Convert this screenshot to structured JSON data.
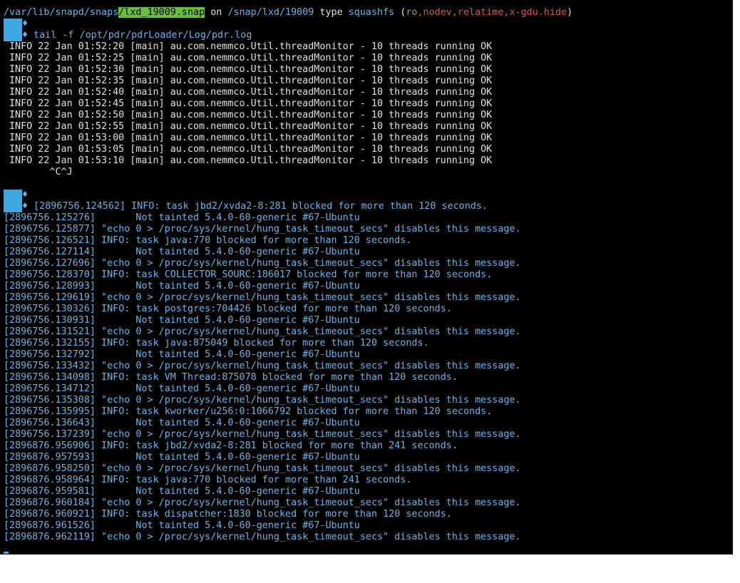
{
  "mount": {
    "path_prefix": "/var/lib/snapd/snaps",
    "path_highlight": "/lxd_19009.snap",
    "on_word": " on ",
    "target": "/snap/lxd/19009",
    "type_word": " type ",
    "fstype": "squashfs",
    "opts_open": " (",
    "opt_ro": "ro",
    "opt_rest": ",nodev,relatime,x-gdu.hide",
    "opts_close": ")"
  },
  "prompt": {
    "diamond": "♦",
    "command": " tail -f /opt/pdr/pdrLoader/Log/pdr.log"
  },
  "info_lines": [
    "INFO 22 Jan 01:52:20 [main] au.com.nemmco.Util.threadMonitor - 10 threads running OK",
    "INFO 22 Jan 01:52:25 [main] au.com.nemmco.Util.threadMonitor - 10 threads running OK",
    "INFO 22 Jan 01:52:30 [main] au.com.nemmco.Util.threadMonitor - 10 threads running OK",
    "INFO 22 Jan 01:52:35 [main] au.com.nemmco.Util.threadMonitor - 10 threads running OK",
    "INFO 22 Jan 01:52:40 [main] au.com.nemmco.Util.threadMonitor - 10 threads running OK",
    "INFO 22 Jan 01:52:45 [main] au.com.nemmco.Util.threadMonitor - 10 threads running OK",
    "INFO 22 Jan 01:52:50 [main] au.com.nemmco.Util.threadMonitor - 10 threads running OK",
    "INFO 22 Jan 01:52:55 [main] au.com.nemmco.Util.threadMonitor - 10 threads running OK",
    "INFO 22 Jan 01:53:00 [main] au.com.nemmco.Util.threadMonitor - 10 threads running OK",
    "INFO 22 Jan 01:53:05 [main] au.com.nemmco.Util.threadMonitor - 10 threads running OK",
    "INFO 22 Jan 01:53:10 [main] au.com.nemmco.Util.threadMonitor - 10 threads running OK"
  ],
  "interrupt": "        ^C^J",
  "kernel_first": " [2896756.124562] INFO: task jbd2/xvda2-8:281 blocked for more than 120 seconds.",
  "kernel_lines": [
    "[2896756.125276]       Not tainted 5.4.0-60-generic #67-Ubuntu",
    "[2896756.125877] \"echo 0 > /proc/sys/kernel/hung_task_timeout_secs\" disables this message.",
    "[2896756.126521] INFO: task java:770 blocked for more than 120 seconds.",
    "[2896756.127114]       Not tainted 5.4.0-60-generic #67-Ubuntu",
    "[2896756.127696] \"echo 0 > /proc/sys/kernel/hung_task_timeout_secs\" disables this message.",
    "[2896756.128370] INFO: task COLLECTOR_SOURC:186017 blocked for more than 120 seconds.",
    "[2896756.128993]       Not tainted 5.4.0-60-generic #67-Ubuntu",
    "[2896756.129619] \"echo 0 > /proc/sys/kernel/hung_task_timeout_secs\" disables this message.",
    "[2896756.130326] INFO: task postgres:704426 blocked for more than 120 seconds.",
    "[2896756.130931]       Not tainted 5.4.0-60-generic #67-Ubuntu",
    "[2896756.131521] \"echo 0 > /proc/sys/kernel/hung_task_timeout_secs\" disables this message.",
    "[2896756.132155] INFO: task java:875049 blocked for more than 120 seconds.",
    "[2896756.132792]       Not tainted 5.4.0-60-generic #67-Ubuntu",
    "[2896756.133432] \"echo 0 > /proc/sys/kernel/hung_task_timeout_secs\" disables this message.",
    "[2896756.134098] INFO: task VM Thread:875078 blocked for more than 120 seconds.",
    "[2896756.134712]       Not tainted 5.4.0-60-generic #67-Ubuntu",
    "[2896756.135308] \"echo 0 > /proc/sys/kernel/hung_task_timeout_secs\" disables this message.",
    "[2896756.135995] INFO: task kworker/u256:0:1066792 blocked for more than 120 seconds.",
    "[2896756.136643]       Not tainted 5.4.0-60-generic #67-Ubuntu",
    "[2896756.137239] \"echo 0 > /proc/sys/kernel/hung_task_timeout_secs\" disables this message.",
    "[2896876.956906] INFO: task jbd2/xvda2-8:281 blocked for more than 241 seconds.",
    "[2896876.957593]       Not tainted 5.4.0-60-generic #67-Ubuntu",
    "[2896876.958250] \"echo 0 > /proc/sys/kernel/hung_task_timeout_secs\" disables this message.",
    "[2896876.958964] INFO: task java:770 blocked for more than 241 seconds.",
    "[2896876.959581]       Not tainted 5.4.0-60-generic #67-Ubuntu",
    "[2896876.960184] \"echo 0 > /proc/sys/kernel/hung_task_timeout_secs\" disables this message.",
    "[2896876.960921] INFO: task dispatcher:1830 blocked for more than 120 seconds.",
    "[2896876.961526]       Not tainted 5.4.0-60-generic #67-Ubuntu",
    "[2896876.962119] \"echo 0 > /proc/sys/kernel/hung_task_timeout_secs\" disables this message."
  ],
  "colors": {
    "background": "#000000",
    "text": "#d6d6d6",
    "kernel": "#6fb4e6",
    "highlight": "#6bbf3e",
    "prompt_block": "#3fa8e0"
  }
}
